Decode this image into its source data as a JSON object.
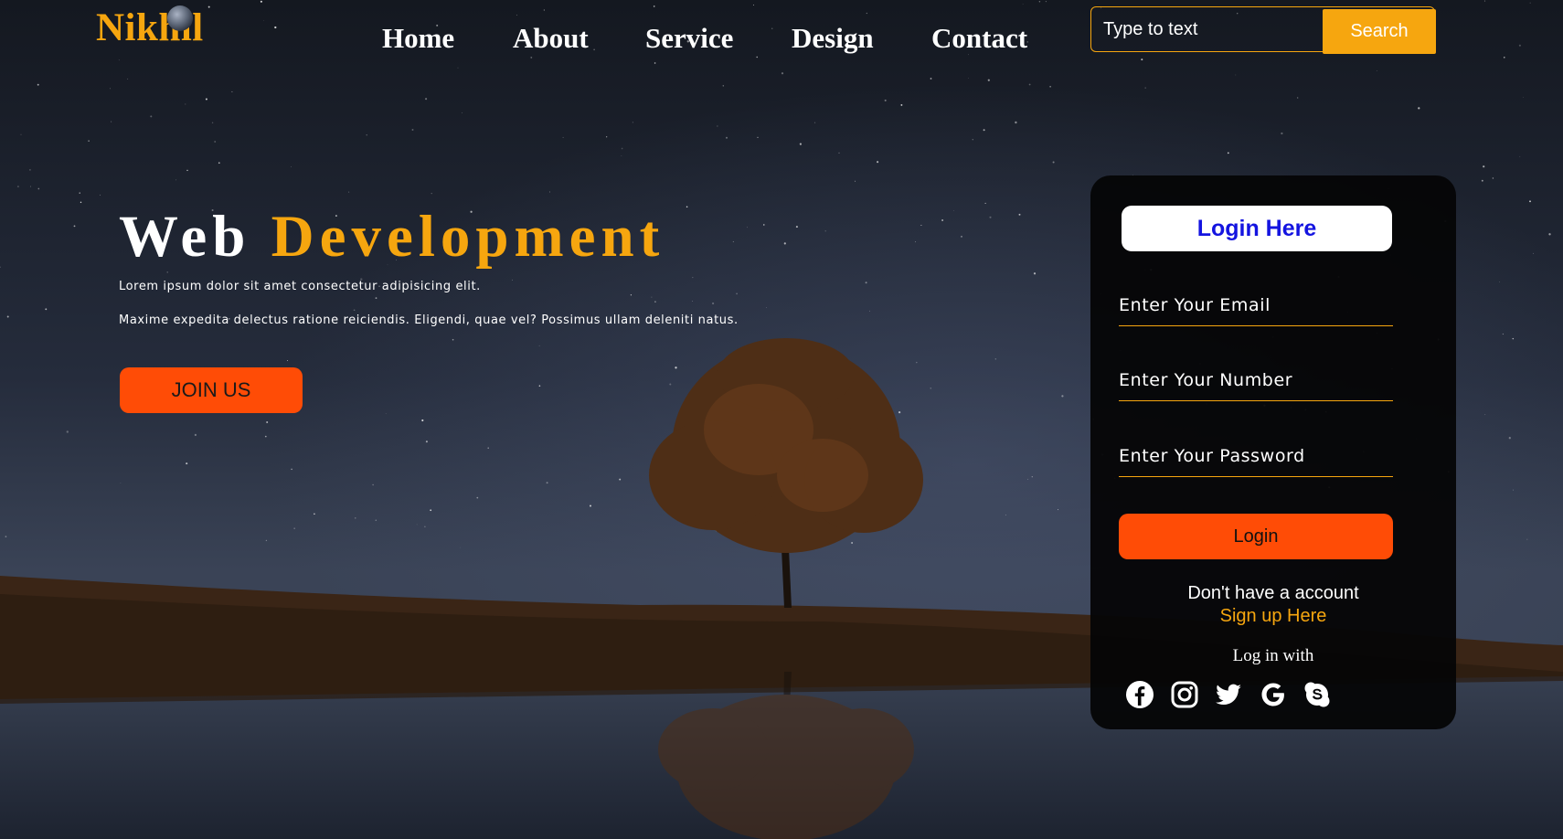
{
  "brand": {
    "name": "Nikhil",
    "accent_color": "#f6a60f"
  },
  "nav": {
    "items": [
      {
        "label": "Home"
      },
      {
        "label": "About"
      },
      {
        "label": "Service"
      },
      {
        "label": "Design"
      },
      {
        "label": "Contact"
      }
    ]
  },
  "search": {
    "placeholder": "Type to text",
    "button_label": "Search"
  },
  "hero": {
    "title_primary": "Web",
    "title_accent": "Development",
    "line1": "Lorem ipsum dolor sit amet consectetur adipisicing elit.",
    "line2": "Maxime expedita delectus ratione reiciendis. Eligendi, quae vel? Possimus ullam deleniti natus.",
    "cta_label": "JOIN US"
  },
  "login": {
    "heading": "Login Here",
    "email_placeholder": "Enter Your Email",
    "number_placeholder": "Enter Your Number",
    "password_placeholder": "Enter Your Password",
    "button_label": "Login",
    "no_account_text": "Don't have a account",
    "signup_label": "Sign up Here",
    "login_with_text": "Log in with",
    "social_icons": [
      "facebook-icon",
      "instagram-icon",
      "twitter-icon",
      "google-icon",
      "skype-icon"
    ]
  },
  "colors": {
    "orange_button": "#ff4c06",
    "heading_blue": "#1414e0"
  }
}
